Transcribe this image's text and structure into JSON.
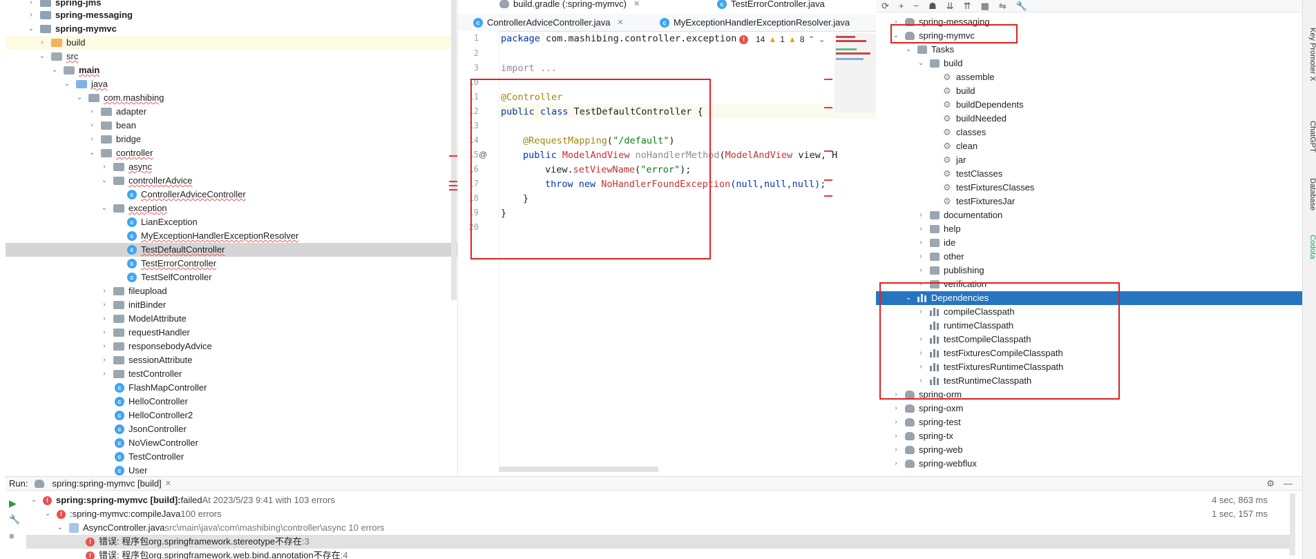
{
  "project_tree": [
    {
      "label": "spring-jms",
      "bold": true
    },
    {
      "label": "spring-messaging",
      "bold": true
    },
    {
      "label": "spring-mymvc",
      "bold": true
    },
    {
      "label": "build"
    },
    {
      "label": "src"
    },
    {
      "label": "main",
      "bold": true
    },
    {
      "label": "java"
    },
    {
      "label": "com.mashibing"
    },
    {
      "label": "adapter"
    },
    {
      "label": "bean"
    },
    {
      "label": "bridge"
    },
    {
      "label": "controller"
    },
    {
      "label": "async"
    },
    {
      "label": "controllerAdvice"
    },
    {
      "label": "ControllerAdviceController"
    },
    {
      "label": "exception"
    },
    {
      "label": "LianException"
    },
    {
      "label": "MyExceptionHandlerExceptionResolver"
    },
    {
      "label": "TestDefaultController"
    },
    {
      "label": "TestErrorController"
    },
    {
      "label": "TestSelfController"
    },
    {
      "label": "fileupload"
    },
    {
      "label": "initBinder"
    },
    {
      "label": "ModelAttribute"
    },
    {
      "label": "requestHandler"
    },
    {
      "label": "responsebodyAdvice"
    },
    {
      "label": "sessionAttribute"
    },
    {
      "label": "testController"
    },
    {
      "label": "FlashMapController"
    },
    {
      "label": "HelloController"
    },
    {
      "label": "HelloController2"
    },
    {
      "label": "JsonController"
    },
    {
      "label": "NoViewController"
    },
    {
      "label": "TestController"
    },
    {
      "label": "User"
    }
  ],
  "editor": {
    "top_tabs": [
      "build.gradle (:spring-mymvc)",
      "TestErrorController.java"
    ],
    "tabs": [
      "ControllerAdviceController.java",
      "MyExceptionHandlerExceptionResolver.java"
    ],
    "line_numbers": [
      "1",
      "2",
      "3",
      "10",
      "11",
      "12",
      "13",
      "14",
      "15",
      "16",
      "17",
      "18",
      "19",
      "20"
    ],
    "inspection": {
      "errors": "14",
      "warnings": "1",
      "weak": "8"
    },
    "code": {
      "l1_kw": "package",
      "l1_rest": " com.mashibing.controller.exception",
      "l3_kw": "import",
      "l3_rest": " ...",
      "l11": "@Controller",
      "l12_kw": "public class",
      "l12_rest": " TestDefaultController {",
      "l14_ann": "@RequestMapping",
      "l14_paren": "(",
      "l14_str": "\"/default\"",
      "l14_end": ")",
      "l15_kw": "public",
      "l15_type": " ModelAndView",
      "l15_name": " noHandlerMethod",
      "l15_p": "(",
      "l15_type2": "ModelAndView",
      "l15_rest": " view, H",
      "l16_obj": "view.",
      "l16_fn": "setViewName",
      "l16_p": "(",
      "l16_str": "\"error\"",
      "l16_e": ");",
      "l17_kw": "throw new",
      "l17_cls": " NoHandlerFoundException",
      "l17_rest": "(null,null,null);",
      "l18": "}",
      "l19": "}"
    }
  },
  "gradle_tree": [
    {
      "label": "spring-messaging"
    },
    {
      "label": "spring-mymvc"
    },
    {
      "label": "Tasks"
    },
    {
      "label": "build"
    },
    {
      "label": "assemble"
    },
    {
      "label": "build"
    },
    {
      "label": "buildDependents"
    },
    {
      "label": "buildNeeded"
    },
    {
      "label": "classes"
    },
    {
      "label": "clean"
    },
    {
      "label": "jar"
    },
    {
      "label": "testClasses"
    },
    {
      "label": "testFixturesClasses"
    },
    {
      "label": "testFixturesJar"
    },
    {
      "label": "documentation"
    },
    {
      "label": "help"
    },
    {
      "label": "ide"
    },
    {
      "label": "other"
    },
    {
      "label": "publishing"
    },
    {
      "label": "verification"
    },
    {
      "label": "Dependencies"
    },
    {
      "label": "compileClasspath"
    },
    {
      "label": "runtimeClasspath"
    },
    {
      "label": "testCompileClasspath"
    },
    {
      "label": "testFixturesCompileClasspath"
    },
    {
      "label": "testFixturesRuntimeClasspath"
    },
    {
      "label": "testRuntimeClasspath"
    },
    {
      "label": "spring-orm"
    },
    {
      "label": "spring-oxm"
    },
    {
      "label": "spring-test"
    },
    {
      "label": "spring-tx"
    },
    {
      "label": "spring-web"
    },
    {
      "label": "spring-webflux"
    }
  ],
  "side_strip": [
    "Key Promoter X",
    "ChatGPT",
    "Database",
    "Codota"
  ],
  "run": {
    "label": "Run:",
    "tab": "spring:spring-mymvc [build]",
    "rows": [
      {
        "title": "spring:spring-mymvc [build]:",
        "status": " failed",
        "detail": " At 2023/5/23 9:41 with 103 errors",
        "time": "4 sec, 863 ms"
      },
      {
        "title": ":spring-mymvc:compileJava",
        "detail": " 100 errors",
        "time": "1 sec, 157 ms"
      },
      {
        "title": "AsyncController.java",
        "detail": " src\\main\\java\\com\\mashibing\\controller\\async 10 errors"
      },
      {
        "title": "错误: 程序包org.springframework.stereotype不存在",
        "detail": " :3"
      },
      {
        "title": "错误: 程序包org.springframework.web.bind.annotation不存在",
        "detail": " :4"
      }
    ]
  }
}
